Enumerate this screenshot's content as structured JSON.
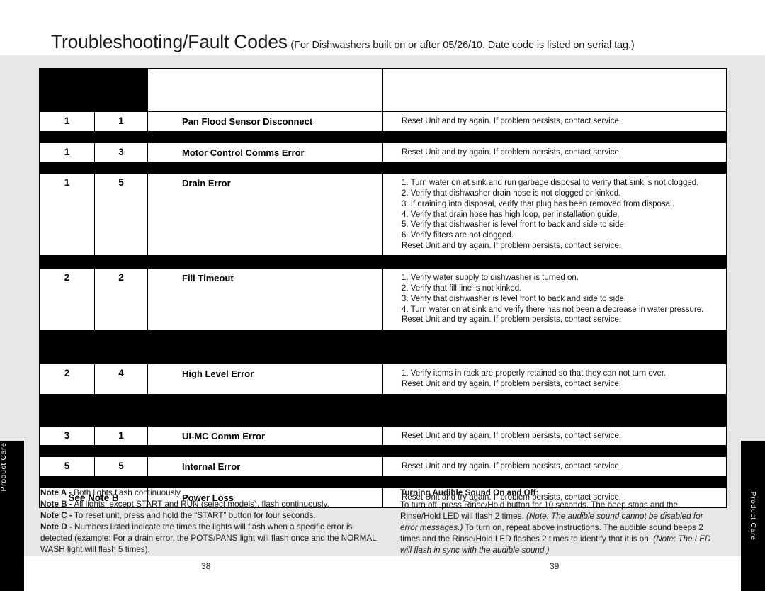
{
  "document": {
    "title_main": "Troubleshooting/Fault Codes",
    "title_sub": "(For Dishwashers built on or after 05/26/10. Date code is listed on serial tag.)",
    "side_tab_label": "Product Care",
    "folio_left": "38",
    "folio_right": "39",
    "colors": {
      "page_background": "#ffffff",
      "content_band": "#e7e7e7",
      "table_rule": "#000000",
      "text": "#1a1a1a"
    }
  },
  "table": {
    "header": {
      "col_a": "",
      "col_b": "",
      "col_c": "",
      "col_d": ""
    },
    "rows": [
      {
        "code_a": "1",
        "code_b": "1",
        "description": "Pan Flood Sensor Disconnect",
        "solution": [
          "Reset Unit and try again. If problem persists, contact service."
        ]
      },
      {
        "code_a": "1",
        "code_b": "3",
        "description": "Motor Control Comms Error",
        "solution": [
          "Reset Unit and try again. If problem persists, contact service."
        ]
      },
      {
        "code_a": "1",
        "code_b": "5",
        "description": "Drain Error",
        "solution": [
          "1. Turn water on at sink and run garbage disposal to verify that sink is not clogged.",
          "2. Verify that dishwasher drain hose is not clogged or kinked.",
          "3. If draining into disposal, verify that plug has been removed from disposal.",
          "4. Verify that drain hose has high loop, per installation guide.",
          "5. Verify that dishwasher is level front to back and side to side.",
          "6. Verify filters are not clogged.",
          "Reset Unit and try again. If problem persists, contact service."
        ]
      },
      {
        "code_a": "2",
        "code_b": "2",
        "description": "Fill Timeout",
        "solution": [
          "1. Verify water supply to dishwasher is turned on.",
          "2. Verify that fill line is not kinked.",
          "3. Verify that dishwasher is level front to back and side to side.",
          "4. Turn water on at sink and verify there has not been a decrease in water pressure.",
          "Reset Unit and try again. If problem persists, contact service."
        ]
      },
      {
        "code_a": "2",
        "code_b": "4",
        "description": "High Level Error",
        "solution": [
          "1. Verify items in rack are properly retained so that they can not turn over.",
          "Reset Unit and try again. If problem persists, contact service."
        ]
      },
      {
        "code_a": "3",
        "code_b": "1",
        "description": "UI-MC Comm Error",
        "solution": [
          "Reset Unit and try again. If problem persists, contact service."
        ]
      },
      {
        "code_a": "5",
        "code_b": "5",
        "description": "Internal Error",
        "solution": [
          "Reset Unit and try again. If problem persists, contact service."
        ]
      },
      {
        "code_span": "See Note B",
        "description": "Power Loss",
        "solution": [
          "Reset Unit and try again. If problem persists, contact service."
        ]
      }
    ]
  },
  "notes": {
    "left": [
      {
        "label": "Note A -",
        "text": " Both lights flash continuously."
      },
      {
        "label": "Note B -",
        "text": " All lights, except START and RUN (select models), flash continuously."
      },
      {
        "label": "Note C -",
        "text": " To reset unit, press and hold the “START” button for four seconds."
      },
      {
        "label": "Note D -",
        "text": " Numbers listed indicate the times the lights will flash when a specific error is detected (example: For a drain error, the POTS/PANS light will flash once and the NORMAL WASH light will flash 5 times)."
      }
    ],
    "right": {
      "heading": "Turning Audible Sound On and Off:",
      "body_1": "To turn off, press Rinse/Hold button for 10 seconds. The beep stops and the Rinse/Hold LED will flash 2 times. ",
      "italic_1": "(Note: The audible sound cannot be disabled for error messages.)",
      "body_2": " To turn on, repeat above instructions. The audible sound beeps 2 times and the Rinse/Hold LED flashes 2 times to identify that it is on.",
      "italic_2": "(Note: The LED will flash in sync with the audible sound.)"
    }
  }
}
